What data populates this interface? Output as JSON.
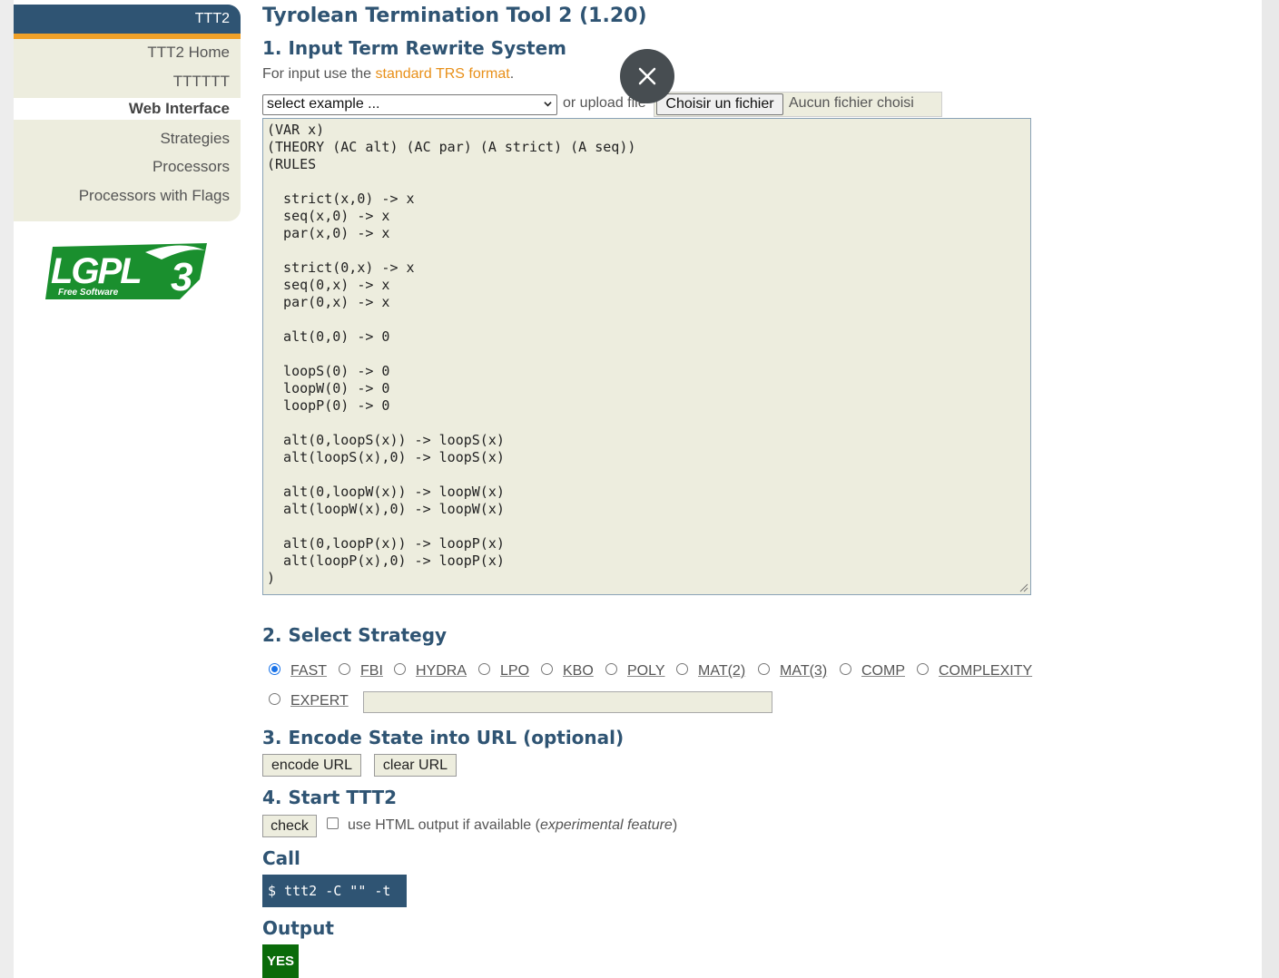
{
  "sidebar": {
    "header": "TTT2",
    "items": [
      {
        "label": "TTT2 Home"
      },
      {
        "label": "TTTTTT"
      },
      {
        "label": "Web Interface"
      },
      {
        "label": "Strategies"
      },
      {
        "label": "Processors"
      },
      {
        "label": "Processors with Flags"
      }
    ],
    "logo": {
      "main_text": "LGPL",
      "version": "3",
      "sub_text": "Free Software",
      "color": "#1a8f2e"
    }
  },
  "main": {
    "title": "Tyrolean Termination Tool 2 (1.20)",
    "section1": {
      "heading": "1. Input Term Rewrite System",
      "intro_prefix": "For input use the ",
      "intro_link": "standard TRS format",
      "intro_suffix": ".",
      "example_select": "select example ...",
      "upload_text": "or upload file",
      "file_button": "Choisir un fichier",
      "file_status": "Aucun fichier choisi",
      "trs_text": "(VAR x)\n(THEORY (AC alt) (AC par) (A strict) (A seq))\n(RULES\n\n  strict(x,0) -> x\n  seq(x,0) -> x\n  par(x,0) -> x\n\n  strict(0,x) -> x\n  seq(0,x) -> x\n  par(0,x) -> x\n\n  alt(0,0) -> 0\n\n  loopS(0) -> 0\n  loopW(0) -> 0\n  loopP(0) -> 0\n\n  alt(0,loopS(x)) -> loopS(x)\n  alt(loopS(x),0) -> loopS(x)\n\n  alt(0,loopW(x)) -> loopW(x)\n  alt(loopW(x),0) -> loopW(x)\n\n  alt(0,loopP(x)) -> loopP(x)\n  alt(loopP(x),0) -> loopP(x)\n)"
    },
    "section2": {
      "heading": "2. Select Strategy",
      "selected": "FAST",
      "strategies": [
        "FAST",
        "FBI",
        "HYDRA",
        "LPO",
        "KBO",
        "POLY",
        "MAT(2)",
        "MAT(3)",
        "COMP",
        "COMPLEXITY",
        "EXPERT"
      ],
      "expert_value": ""
    },
    "section3": {
      "heading": "3. Encode State into URL (optional)",
      "encode_button": "encode URL",
      "clear_button": "clear URL"
    },
    "section4": {
      "heading": "4. Start TTT2",
      "check_button": "check",
      "html_output_checked": false,
      "html_output_label": "use HTML output if available (",
      "html_output_em": "experimental feature",
      "html_output_suffix": ")"
    },
    "call": {
      "heading": "Call",
      "command": "$ ttt2 -C \"\" -t"
    },
    "output": {
      "heading": "Output",
      "result": "YES",
      "result_color": "#0a6b0a"
    }
  },
  "overlay": {
    "close_icon": "close-icon"
  },
  "colors": {
    "accent": "#2f5473",
    "link": "#e8901a",
    "highlight": "#f0a128",
    "panel": "#ededde"
  }
}
